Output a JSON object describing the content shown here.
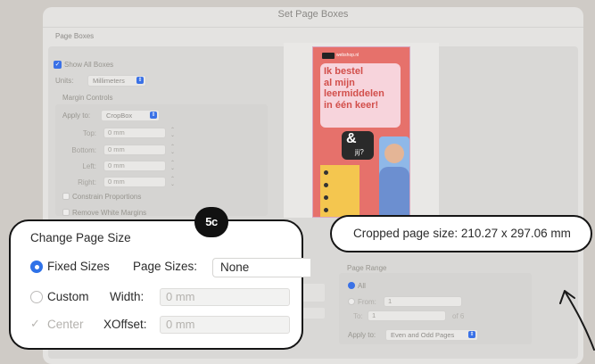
{
  "dialog": {
    "title": "Set Page Boxes",
    "group_title": "Page Boxes"
  },
  "page_boxes": {
    "show_all_boxes": "Show All Boxes",
    "units_label": "Units:",
    "units_value": "Millimeters",
    "margin_controls": "Margin Controls",
    "apply_to_label": "Apply to:",
    "apply_to_value": "CropBox",
    "top_label": "Top:",
    "top_value": "0 mm",
    "bottom_label": "Bottom:",
    "bottom_value": "0 mm",
    "left_label": "Left:",
    "left_value": "0 mm",
    "right_label": "Right:",
    "right_value": "0 mm",
    "constrain": "Constrain Proportions",
    "remove_white": "Remove White Margins"
  },
  "preview": {
    "cropped_size": "Cropped page size: 210.27 x 297.06 mm",
    "poster_brand": "webshop.nl",
    "poster_headline": [
      "Ik bestel",
      "al mijn",
      "leermiddelen",
      "in één keer!"
    ],
    "poster_bubble_big": "&",
    "poster_bubble_small": "jij?"
  },
  "step_badge": "5c",
  "change_page_size": {
    "title": "Change Page Size",
    "fixed_sizes": "Fixed Sizes",
    "page_sizes_label": "Page Sizes:",
    "page_sizes_value": "None",
    "custom": "Custom",
    "width_label": "Width:",
    "width_value": "0 mm",
    "center": "Center",
    "xoffset_label": "XOffset:",
    "xoffset_value": "0 mm"
  },
  "page_range": {
    "title": "Page Range",
    "all": "All",
    "from_label": "From:",
    "from_value": "1",
    "to_label": "To:",
    "to_value": "1",
    "of": "of 6",
    "apply_to_label": "Apply to:",
    "apply_to_value": "Even and Odd Pages"
  },
  "colors": {
    "accent": "#2f72e8",
    "poster_bg": "#e6716b",
    "poster_yellow": "#f4c64f",
    "poster_pink": "#f7d4dc"
  }
}
